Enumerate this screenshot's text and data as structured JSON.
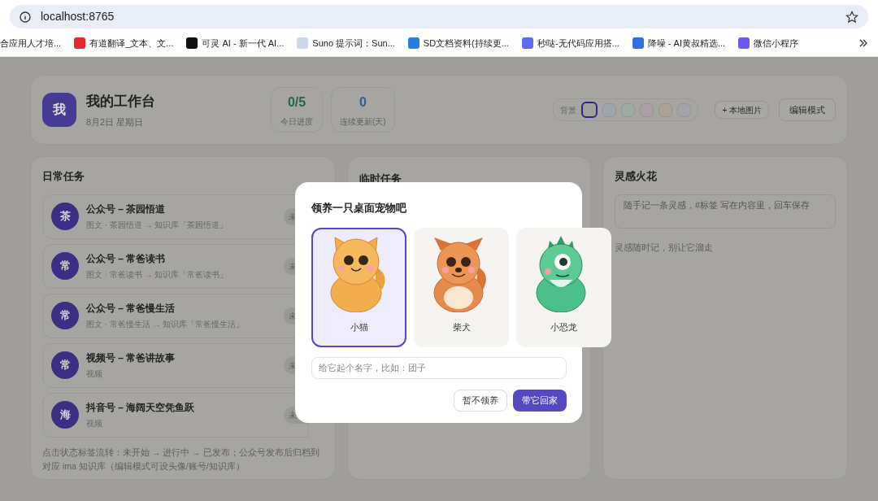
{
  "browser": {
    "url": "localhost:8765",
    "bookmarks": [
      {
        "label": "合应用人才培..."
      },
      {
        "label": "有道翻译_文本、文...",
        "color": "#e8272e"
      },
      {
        "label": "可灵 AI - 新一代 AI...",
        "color": "#111111"
      },
      {
        "label": "Suno 提示词：Sun...",
        "color": "#cfd8e6"
      },
      {
        "label": "SD文档资料(持续更...",
        "color": "#2a7de1"
      },
      {
        "label": "秒哒-无代码应用搭...",
        "color": "#5b6cf0"
      },
      {
        "label": "降噪 - AI黄叔精选...",
        "color": "#2f6fe4"
      },
      {
        "label": "微信小程序",
        "color": "#6b5cf0"
      }
    ]
  },
  "header": {
    "avatar": "我",
    "title": "我的工作台",
    "date": "8月2日 星期日",
    "stats": [
      {
        "value": "0/5",
        "label": "今日进度",
        "color": "#1e6b44"
      },
      {
        "value": "0",
        "label": "连续更新(天)",
        "color": "#305f93"
      }
    ],
    "background": {
      "label": "背景",
      "swatches": [
        {
          "color": "#a19f9a",
          "selected": true
        },
        {
          "color": "#9fa5ae",
          "selected": false
        },
        {
          "color": "#9eaaa4",
          "selected": false
        },
        {
          "color": "#aa9fa4",
          "selected": false
        },
        {
          "color": "#aba293",
          "selected": false
        },
        {
          "color": "#a4a2aa",
          "selected": false
        }
      ]
    },
    "local_image_button": "+ 本地图片",
    "edit_button": "编辑模式"
  },
  "daily_tasks": {
    "title": "日常任务",
    "items": [
      {
        "avatar": "茶",
        "title": "公众号 – 茶园悟道",
        "subtitle": "图文 · 茶园悟道 → 知识库「茶园悟道」",
        "status": "未"
      },
      {
        "avatar": "常",
        "title": "公众号 – 常爸读书",
        "subtitle": "图文 · 常爸读书 → 知识库「常爸读书」",
        "status": "未"
      },
      {
        "avatar": "常",
        "title": "公众号 – 常爸慢生活",
        "subtitle": "图文 · 常爸慢生活 → 知识库「常爸慢生活」",
        "status": "未"
      },
      {
        "avatar": "常",
        "title": "视频号 – 常爸讲故事",
        "subtitle": "视频",
        "status": "未"
      },
      {
        "avatar": "海",
        "title": "抖音号 – 海阔天空凭鱼跃",
        "subtitle": "视频",
        "status": "未"
      }
    ],
    "hint": "点击状态标签流转：未开始 → 进行中 → 已发布；公众号发布后归档到对应 ima 知识库（编辑模式可设头像/账号/知识库）"
  },
  "temp_tasks": {
    "title": "临时任务"
  },
  "inspiration": {
    "title": "灵感火花",
    "placeholder": "随手记一条灵感，#标签 写在内容里，回车保存",
    "empty_text": "灵感随时记，别让它溜走"
  },
  "dialog": {
    "title": "领养一只桌面宠物吧",
    "pets": [
      {
        "kind": "cat",
        "name": "小猫",
        "selected": true
      },
      {
        "kind": "dog",
        "name": "柴犬",
        "selected": false
      },
      {
        "kind": "dino",
        "name": "小恐龙",
        "selected": false
      }
    ],
    "name_placeholder": "给它起个名字，比如：团子",
    "cancel": "暂不领养",
    "confirm": "带它回家"
  }
}
